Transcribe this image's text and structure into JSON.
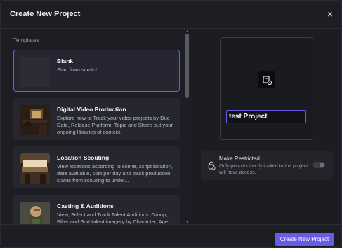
{
  "dialog": {
    "title": "Create New Project",
    "close_label": "×"
  },
  "templates": {
    "section_label": "Templates",
    "items": [
      {
        "title": "Blank",
        "description": "Start from scratch"
      },
      {
        "title": "Digital Video Production",
        "description": "Explore how to Track your video projects by Due Date, Release Platform, Topic and Share out your ongoing libraries of content."
      },
      {
        "title": "Location Scouting",
        "description": "View locations according to scene, script location, date available, cost per day and track production status from scouting to under..."
      },
      {
        "title": "Casting & Auditions",
        "description": "View, Select and Track Talent Auditions. Group, Filter and Sort talent imagery by Character, Age, Gender..."
      }
    ]
  },
  "preview": {
    "project_name": "test Project",
    "icon": "folder-settings-icon"
  },
  "restricted": {
    "title": "Make Restricted",
    "description": "Only people directly invited to the project will have access.",
    "enabled": false,
    "icon": "lock-icon"
  },
  "footer": {
    "create_label": "Create New Project"
  },
  "colors": {
    "accent": "#6a5be6",
    "background": "#1c1d22",
    "card": "#26272e"
  }
}
